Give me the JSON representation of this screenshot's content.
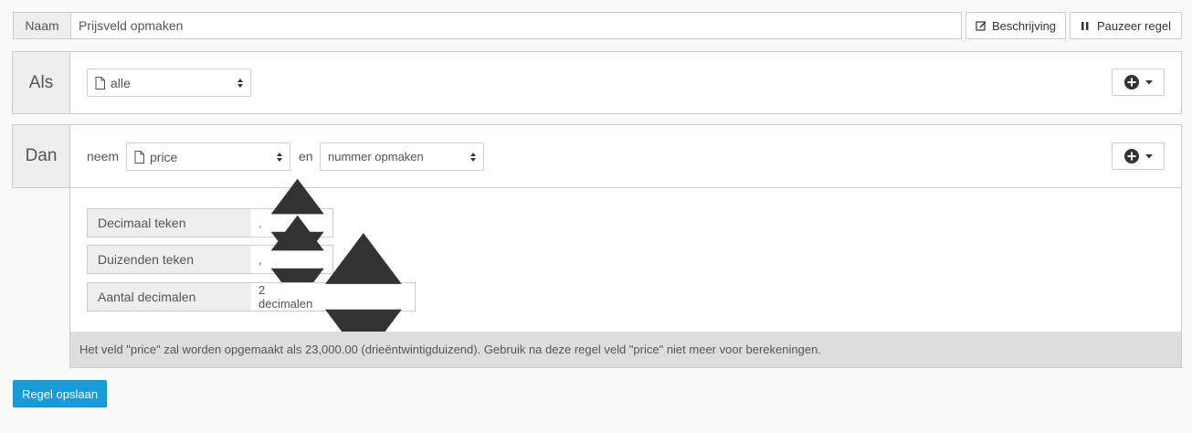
{
  "name_row": {
    "label": "Naam",
    "value": "Prijsveld opmaken",
    "description_button": "Beschrijving",
    "pause_button": "Pauzeer regel"
  },
  "if_block": {
    "label": "Als",
    "selector_value": "alle"
  },
  "then_block": {
    "label": "Dan",
    "take_word": "neem",
    "field_value": "price",
    "and_word": "en",
    "action_value": "nummer opmaken",
    "options": [
      {
        "label": "Decimaal teken",
        "value": "."
      },
      {
        "label": "Duizenden teken",
        "value": ","
      },
      {
        "label": "Aantal decimalen",
        "value": "2 decimalen"
      }
    ],
    "info_text": "Het veld \"price\" zal worden opgemaakt als 23,000.00 (drieëntwintigduizend). Gebruik na deze regel veld \"price\" niet meer voor berekeningen."
  },
  "save_button": "Regel opslaan",
  "icons": {
    "description": "edit-icon",
    "pause": "pause-icon",
    "add": "plus-circle-icon",
    "document": "document-icon"
  },
  "colors": {
    "primary": "#1a9bd7",
    "info_bg": "#dddddd"
  }
}
